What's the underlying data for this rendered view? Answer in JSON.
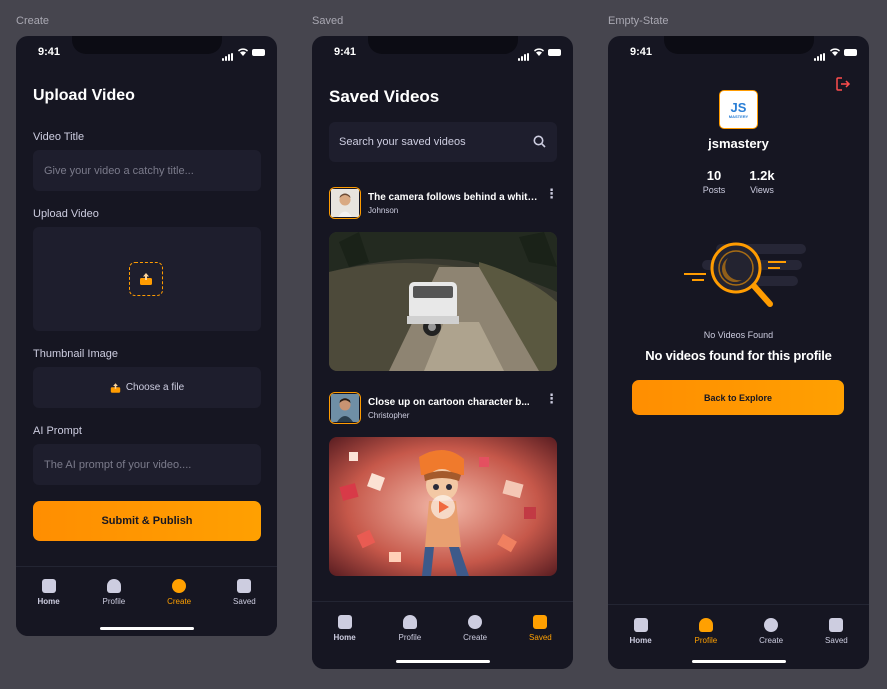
{
  "frames": {
    "create": "Create",
    "saved": "Saved",
    "empty": "Empty-State"
  },
  "status_time": "9:41",
  "create": {
    "title": "Upload Video",
    "video_title_label": "Video Title",
    "video_title_placeholder": "Give your video a catchy title...",
    "upload_video_label": "Upload Video",
    "thumbnail_label": "Thumbnail Image",
    "choose_file": "Choose a file",
    "ai_prompt_label": "AI Prompt",
    "ai_prompt_placeholder": "The AI prompt of your video....",
    "submit": "Submit & Publish"
  },
  "saved": {
    "title": "Saved Videos",
    "search_placeholder": "Search your saved videos",
    "videos": [
      {
        "title": "The camera follows behind a white...",
        "creator": "Johnson"
      },
      {
        "title": "Close up on cartoon character b...",
        "creator": "Christopher"
      }
    ]
  },
  "empty": {
    "logo_text": "JS",
    "logo_sub": "MASTERY",
    "username": "jsmastery",
    "posts_count": "10",
    "posts_label": "Posts",
    "views_count": "1.2k",
    "views_label": "Views",
    "empty_small": "No Videos Found",
    "empty_big": "No videos found for this profile",
    "back_button": "Back to Explore"
  },
  "tabs": {
    "home": "Home",
    "profile": "Profile",
    "create": "Create",
    "saved": "Saved"
  },
  "colors": {
    "background": "#161622",
    "surface": "#1e1e2d",
    "accent": "#ffa001"
  }
}
